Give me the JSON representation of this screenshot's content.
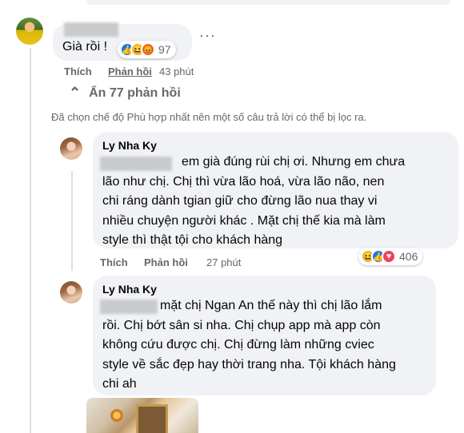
{
  "comment_main": {
    "text": "Già rồi !",
    "reaction_count": "97",
    "reactions": [
      "like-icon",
      "haha-icon",
      "angry-icon"
    ],
    "actions": {
      "like": "Thích",
      "reply": "Phản hồi",
      "time": "43 phút"
    },
    "more": "···"
  },
  "hide_replies": {
    "label": "Ẩn 77 phản hồi"
  },
  "filter_notice": "Đã chọn chế độ Phù hợp nhất nên một số câu trả lời có thể bị lọc ra.",
  "reply1": {
    "author": "Ly Nha Ky",
    "lines": [
      "em già đúng rùi chị ơi. Nhưng em chưa",
      "lão như chị. Chị thì vừa lão hoá, vừa lão não, nen",
      "chi ráng dành tgian giữ cho đừng lão nua thay vi",
      "nhiều chuyện người khác . Mặt chị thế kia mà làm",
      "style thì thật tội cho khách hàng"
    ],
    "actions": {
      "like": "Thích",
      "reply": "Phản hồi",
      "time": "27 phút"
    },
    "reaction_count": "406",
    "reactions": [
      "haha-icon",
      "like-icon",
      "love-icon"
    ]
  },
  "reply2": {
    "author": "Ly Nha Ky",
    "lines": [
      "mặt chị Ngan An thế này thì chị lão lắm",
      "rồi. Chị bớt sân si nha. Chị chụp app mà app còn",
      "không cứu được chị. Chị đừng làm những cviec",
      "style về sắc đẹp hay thời trang nha. Tội khách hàng",
      "chi ah"
    ]
  },
  "colors": {
    "bubble": "#f0f2f5",
    "meta": "#65676b",
    "like": "#1877f2",
    "haha": "#f7b125",
    "angry": "#e9710f",
    "love": "#f33e58"
  }
}
